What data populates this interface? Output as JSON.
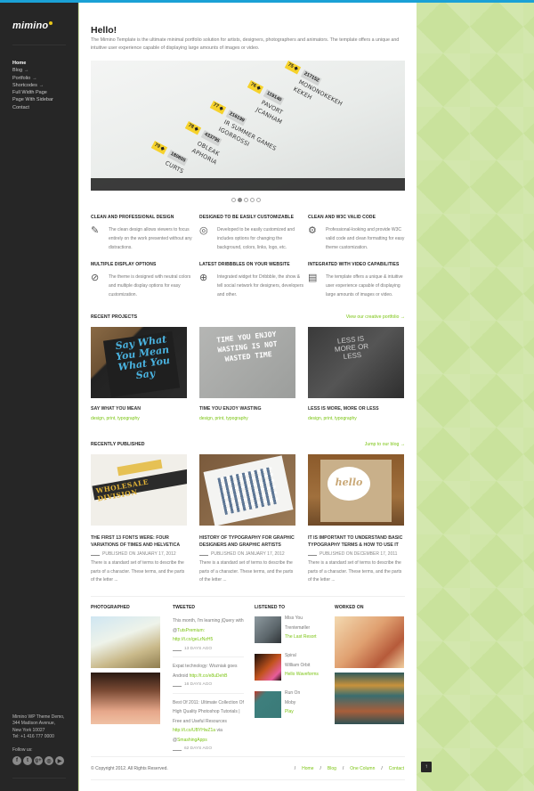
{
  "colors": {
    "accent": "#7bc412",
    "topbar": "#1aa1d6",
    "sidebar_bg": "#262626",
    "logo_dot": "#e8c51a",
    "page_bg": "#cde3a2"
  },
  "sidebar": {
    "logo": "mimino",
    "nav": [
      {
        "label": "Home",
        "active": true,
        "has_arrow": false
      },
      {
        "label": "Blog",
        "has_arrow": true
      },
      {
        "label": "Portfolio",
        "has_arrow": true
      },
      {
        "label": "Shortcodes",
        "has_arrow": true
      },
      {
        "label": "Full Width Page",
        "has_arrow": false
      },
      {
        "label": "Page With Sidebar",
        "has_arrow": false
      },
      {
        "label": "Contact",
        "has_arrow": false
      }
    ],
    "arrow": "→",
    "address": [
      "Mimino WP Theme Demo,",
      "344 Madison Avenue,",
      "New York 10027",
      "Tel: +1 416 777 0000"
    ],
    "follow_label": "Follow us:",
    "socials": [
      {
        "name": "facebook-icon",
        "glyph": "f"
      },
      {
        "name": "twitter-icon",
        "glyph": "t"
      },
      {
        "name": "google-plus-icon",
        "glyph": "g+"
      },
      {
        "name": "dribbble-icon",
        "glyph": "◎"
      },
      {
        "name": "youtube-icon",
        "glyph": "▶"
      }
    ]
  },
  "main": {
    "title": "Hello!",
    "intro": "The Mimino Template is the ultimate minimal portfolio solution for artists, designers, photographers and animators. The template offers a unique and intuitive user experience capable of displaying large amounts of images or video.",
    "slider": {
      "tags": [
        {
          "num": "75 ◆",
          "id": "217152",
          "lines": [
            "MONONOKEKEH",
            "KEKEH"
          ]
        },
        {
          "num": "76 ◆",
          "id": "119140",
          "lines": [
            "PAVORT",
            "JCANHAM"
          ]
        },
        {
          "num": "77 ◆",
          "id": "216199",
          "lines": [
            "IR SUMMER GAMES",
            "IGORROSSI"
          ]
        },
        {
          "num": "78 ◆",
          "id": "433795",
          "lines": [
            "OBLEAK",
            "APHORIA"
          ]
        },
        {
          "num": "79 ◆",
          "id": "180805",
          "lines": [
            "CURTS"
          ]
        }
      ],
      "slide_count": 5,
      "active_slide": 2
    },
    "features": [
      {
        "icon": "artist-icon",
        "glyph": "✎",
        "title": "CLEAN AND PROFESSIONAL DESIGN",
        "text": "The clean design allows viewers to focus entirely on the work presented without any distractions."
      },
      {
        "icon": "target-icon",
        "glyph": "◎",
        "title": "DESIGNED TO BE EASILY CUSTOMIZABLE",
        "text": "Developed to be easily customized and includes options for changing the background, colors, links, logo, etc."
      },
      {
        "icon": "gear-icon",
        "glyph": "⚙",
        "title": "CLEAN AND W3C VALID CODE",
        "text": "Professional-looking and provide W3C valid code and clean formatting for easy theme customization."
      },
      {
        "icon": "paperclip-icon",
        "glyph": "⊘",
        "title": "MULTIPLE DISPLAY OPTIONS",
        "text": "The theme is designed with neutral colors and multiple display options for easy customization."
      },
      {
        "icon": "dribbble-ball-icon",
        "glyph": "⊕",
        "title": "LATEST DRIBBBLES ON YOUR WEBSITE",
        "text": "Integrated widget for Dribbble, the show & tell social network for designers, developers and other."
      },
      {
        "icon": "film-icon",
        "glyph": "▤",
        "title": "INTEGRATED WITH VIDEO CAPABILITIES",
        "text": "The template offers a unique & intuitive user experience capable of displaying large amounts of images or video."
      }
    ],
    "recent_projects": {
      "title": "RECENT PROJECTS",
      "link": "View our creative portfolio →",
      "items": [
        {
          "title": "SAY WHAT YOU MEAN",
          "tags": "design, print, typography",
          "thumb_text": "Say What You Mean What You Say"
        },
        {
          "title": "TIME YOU ENJOY WASTING",
          "tags": "design, print, typography",
          "thumb_text": "TIME YOU ENJOY WASTING IS NOT WASTED TIME"
        },
        {
          "title": "LESS IS MORE, MORE OR LESS",
          "tags": "design, print, typography",
          "thumb_text": "LESS IS MORE OR LESS"
        }
      ]
    },
    "recently_published": {
      "title": "RECENTLY PUBLISHED",
      "link": "Jump to our blog →",
      "items": [
        {
          "title": "THE FIRST 13 FONTS WERE: FOUR VARIATIONS OF TIMES AND HELVETICA",
          "meta": "PUBLISHED ON JANUARY 17, 2012",
          "excerpt": "There is a standard set of terms to describe the parts of a character. These terms, and the parts of the letter ...",
          "thumb_text": "WHOLESALE DIVISION"
        },
        {
          "title": "HISTORY OF TYPOGRAPHY FOR GRAPHIC DESIGNERS AND GRAPHIC ARTISTS",
          "meta": "PUBLISHED ON JANUARY 17, 2012",
          "excerpt": "There is a standard set of terms to describe the parts of a character. These terms, and the parts of the letter ...",
          "thumb_text": ""
        },
        {
          "title": "IT IS IMPORTANT TO UNDERSTAND BASIC TYPOGRAPHY TERMS & HOW TO USE IT",
          "meta": "PUBLISHED ON DECEMBER 17, 2011",
          "excerpt": "There is a standard set of terms to describe the parts of a character. These terms, and the parts of the letter ...",
          "thumb_text": "hello"
        }
      ]
    },
    "bottom": {
      "photographed": {
        "title": "PHOTOGRAPHED"
      },
      "tweeted": {
        "title": "TWEETED",
        "tweets": [
          {
            "text": "This month, I'm learning jQuery with @",
            "mention": "TutsPremium",
            "link": ": http://t.co/geLzNzH5",
            "ago": "13 DAYS AGO"
          },
          {
            "text": "Expat technology: Wozniak goes Android ",
            "mention": "",
            "link": "http://t.co/e8uDehB",
            "ago": "16 DAYS AGO"
          },
          {
            "text": "Best Of 2011: Ultimate Collection Of High Quality Photoshop Tutorials | Free and Useful Resources ",
            "link": "http://t.co/UBYHwZ1a",
            "via": " via @",
            "mention": "SmashingApps",
            "ago": "62 DAYS AGO"
          }
        ]
      },
      "listened": {
        "title": "LISTENED TO",
        "albums": [
          {
            "song": "Miss You",
            "artist": "Trentemøller",
            "album": "The Last Resort"
          },
          {
            "song": "Spiral",
            "artist": "William Orbit",
            "album": "Hello Waveforms"
          },
          {
            "song": "Run On",
            "artist": "Moby",
            "album": "Play"
          }
        ]
      },
      "worked": {
        "title": "WORKED ON"
      }
    },
    "footer": {
      "copyright": "© Copyright 2012. All Rights Reserved.",
      "links": [
        "Home",
        "Blog",
        "One Column",
        "Contact"
      ],
      "separator": "/",
      "to_top": "↑"
    }
  }
}
